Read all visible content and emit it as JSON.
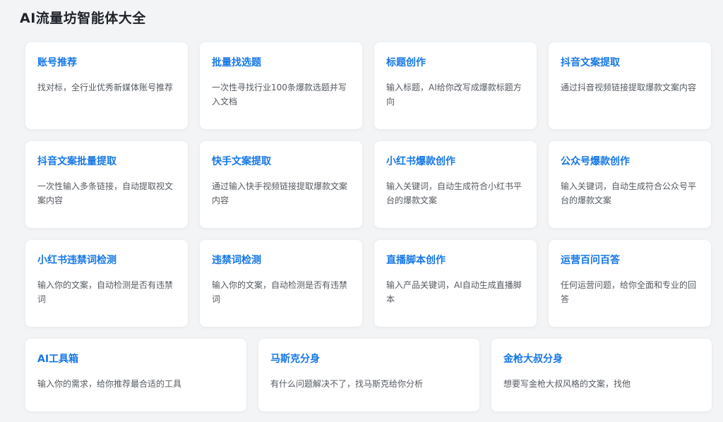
{
  "page": {
    "title": "AI流量坊智能体大全"
  },
  "cards": [
    {
      "title": "账号推荐",
      "desc": "找对标，全行业优秀新媒体账号推荐"
    },
    {
      "title": "批量找选题",
      "desc": "一次性寻找行业100条爆款选题并写入文档"
    },
    {
      "title": "标题创作",
      "desc": "输入标题，AI给你改写成爆款标题方向"
    },
    {
      "title": "抖音文案提取",
      "desc": "通过抖音视频链接提取爆款文案内容"
    },
    {
      "title": "抖音文案批量提取",
      "desc": "一次性输入多条链接，自动提取视文案内容"
    },
    {
      "title": "快手文案提取",
      "desc": "通过输入快手视频链接提取爆款文案内容"
    },
    {
      "title": "小红书爆款创作",
      "desc": "输入关键词，自动生成符合小红书平台的爆款文案"
    },
    {
      "title": "公众号爆款创作",
      "desc": "输入关键词，自动生成符合公众号平台的爆款文案"
    },
    {
      "title": "小红书违禁词检测",
      "desc": "输入你的文案，自动检测是否有违禁词"
    },
    {
      "title": "违禁词检测",
      "desc": "输入你的文案，自动检测是否有违禁词"
    },
    {
      "title": "直播脚本创作",
      "desc": "输入产品关键词，AI自动生成直播脚本"
    },
    {
      "title": "运营百问百答",
      "desc": "任何运营问题，给你全面和专业的回答"
    },
    {
      "title": "AI工具箱",
      "desc": "输入你的需求，给你推荐最合适的工具"
    },
    {
      "title": "马斯克分身",
      "desc": "有什么问题解决不了，找马斯克给你分析"
    },
    {
      "title": "金枪大叔分身",
      "desc": "想要写金枪大叔风格的文案，找他"
    }
  ]
}
